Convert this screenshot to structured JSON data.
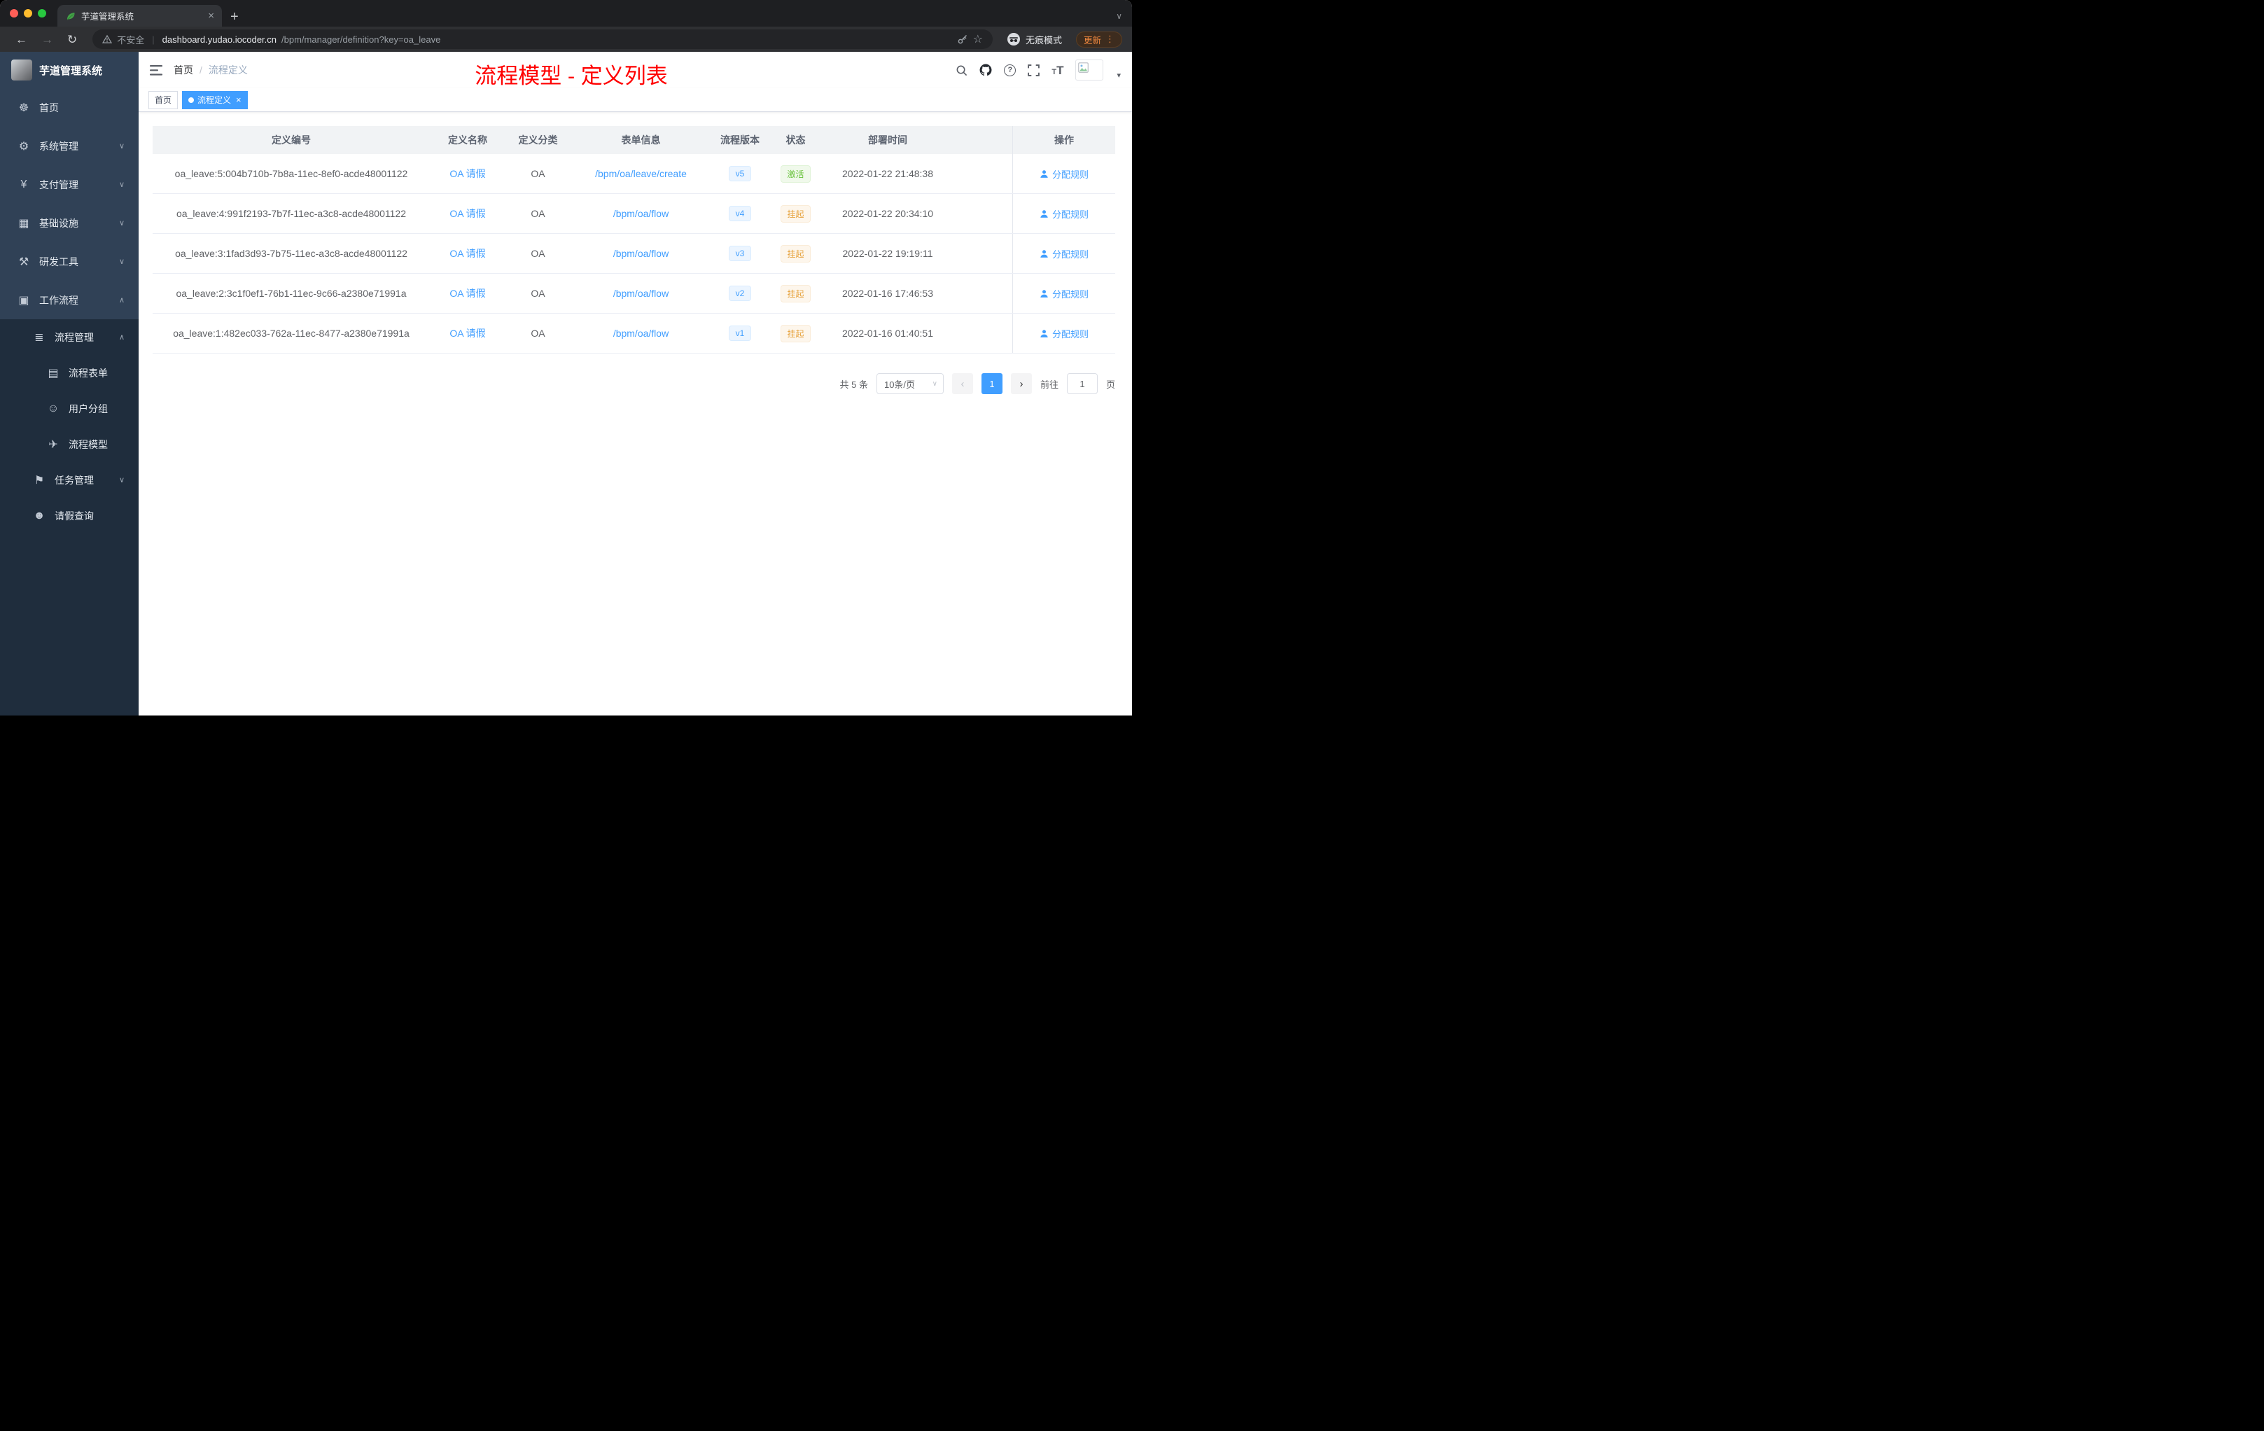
{
  "browser": {
    "tab_title": "芋道管理系统",
    "not_secure_label": "不安全",
    "url_host": "dashboard.yudao.iocoder.cn",
    "url_path": "/bpm/manager/definition?key=oa_leave",
    "incognito_label": "无痕模式",
    "update_label": "更新"
  },
  "sidebar": {
    "app_title": "芋道管理系统",
    "menu": [
      {
        "id": "home",
        "label": "首页",
        "icon": "dashboard-icon",
        "glyph": "☸",
        "level": 1,
        "caret": ""
      },
      {
        "id": "system-mgmt",
        "label": "系统管理",
        "icon": "gear-icon",
        "glyph": "⚙",
        "level": 1,
        "caret": "down"
      },
      {
        "id": "payment-mgmt",
        "label": "支付管理",
        "icon": "yen-icon",
        "glyph": "¥",
        "level": 1,
        "caret": "down"
      },
      {
        "id": "infrastructure",
        "label": "基础设施",
        "icon": "infrastructure-icon",
        "glyph": "▦",
        "level": 1,
        "caret": "down"
      },
      {
        "id": "dev-tools",
        "label": "研发工具",
        "icon": "tools-icon",
        "glyph": "⚒",
        "level": 1,
        "caret": "down"
      },
      {
        "id": "workflow",
        "label": "工作流程",
        "icon": "briefcase-icon",
        "glyph": "▣",
        "level": 1,
        "caret": "up"
      },
      {
        "id": "process-mgmt",
        "label": "流程管理",
        "icon": "list-icon",
        "glyph": "≣",
        "level": 2,
        "caret": "up"
      },
      {
        "id": "process-form",
        "label": "流程表单",
        "icon": "form-icon",
        "glyph": "▤",
        "level": 3,
        "caret": ""
      },
      {
        "id": "user-group",
        "label": "用户分组",
        "icon": "users-icon",
        "glyph": "☺",
        "level": 3,
        "caret": ""
      },
      {
        "id": "process-model",
        "label": "流程模型",
        "icon": "paper-plane-icon",
        "glyph": "✈",
        "level": 3,
        "caret": ""
      },
      {
        "id": "task-mgmt",
        "label": "任务管理",
        "icon": "flag-icon",
        "glyph": "⚑",
        "level": 2,
        "caret": "down"
      },
      {
        "id": "leave-query",
        "label": "请假查询",
        "icon": "user-icon",
        "glyph": "☻",
        "level": 2,
        "caret": ""
      }
    ]
  },
  "header": {
    "breadcrumb": {
      "home": "首页",
      "separator": "/",
      "current": "流程定义"
    },
    "annotation_title": "流程模型 - 定义列表"
  },
  "tags": [
    {
      "label": "首页",
      "active": false
    },
    {
      "label": "流程定义",
      "active": true
    }
  ],
  "table": {
    "columns": [
      "定义编号",
      "定义名称",
      "定义分类",
      "表单信息",
      "流程版本",
      "状态",
      "部署时间",
      "操作"
    ],
    "rows": [
      {
        "id": "oa_leave:5:004b710b-7b8a-11ec-8ef0-acde48001122",
        "name": "OA 请假",
        "category": "OA",
        "form": "/bpm/oa/leave/create",
        "version": "v5",
        "status": "激活",
        "status_type": "active",
        "time": "2022-01-22 21:48:38",
        "action": "分配规则"
      },
      {
        "id": "oa_leave:4:991f2193-7b7f-11ec-a3c8-acde48001122",
        "name": "OA 请假",
        "category": "OA",
        "form": "/bpm/oa/flow",
        "version": "v4",
        "status": "挂起",
        "status_type": "suspended",
        "time": "2022-01-22 20:34:10",
        "action": "分配规则"
      },
      {
        "id": "oa_leave:3:1fad3d93-7b75-11ec-a3c8-acde48001122",
        "name": "OA 请假",
        "category": "OA",
        "form": "/bpm/oa/flow",
        "version": "v3",
        "status": "挂起",
        "status_type": "suspended",
        "time": "2022-01-22 19:19:11",
        "action": "分配规则"
      },
      {
        "id": "oa_leave:2:3c1f0ef1-76b1-11ec-9c66-a2380e71991a",
        "name": "OA 请假",
        "category": "OA",
        "form": "/bpm/oa/flow",
        "version": "v2",
        "status": "挂起",
        "status_type": "suspended",
        "time": "2022-01-16 17:46:53",
        "action": "分配规则"
      },
      {
        "id": "oa_leave:1:482ec033-762a-11ec-8477-a2380e71991a",
        "name": "OA 请假",
        "category": "OA",
        "form": "/bpm/oa/flow",
        "version": "v1",
        "status": "挂起",
        "status_type": "suspended",
        "time": "2022-01-16 01:40:51",
        "action": "分配规则"
      }
    ]
  },
  "pagination": {
    "total": "共 5 条",
    "page_size": "10条/页",
    "prev": "‹",
    "next": "›",
    "current_page": "1",
    "goto_label": "前往",
    "goto_value": "1",
    "page_unit": "页"
  },
  "colors": {
    "accent": "#409eff",
    "status_active_green": "#67c23a",
    "status_suspended_orange": "#e6a23c",
    "annotation_red": "#ff0000",
    "sidebar_bg": "#304156",
    "submenu_bg": "#1f2d3d"
  }
}
